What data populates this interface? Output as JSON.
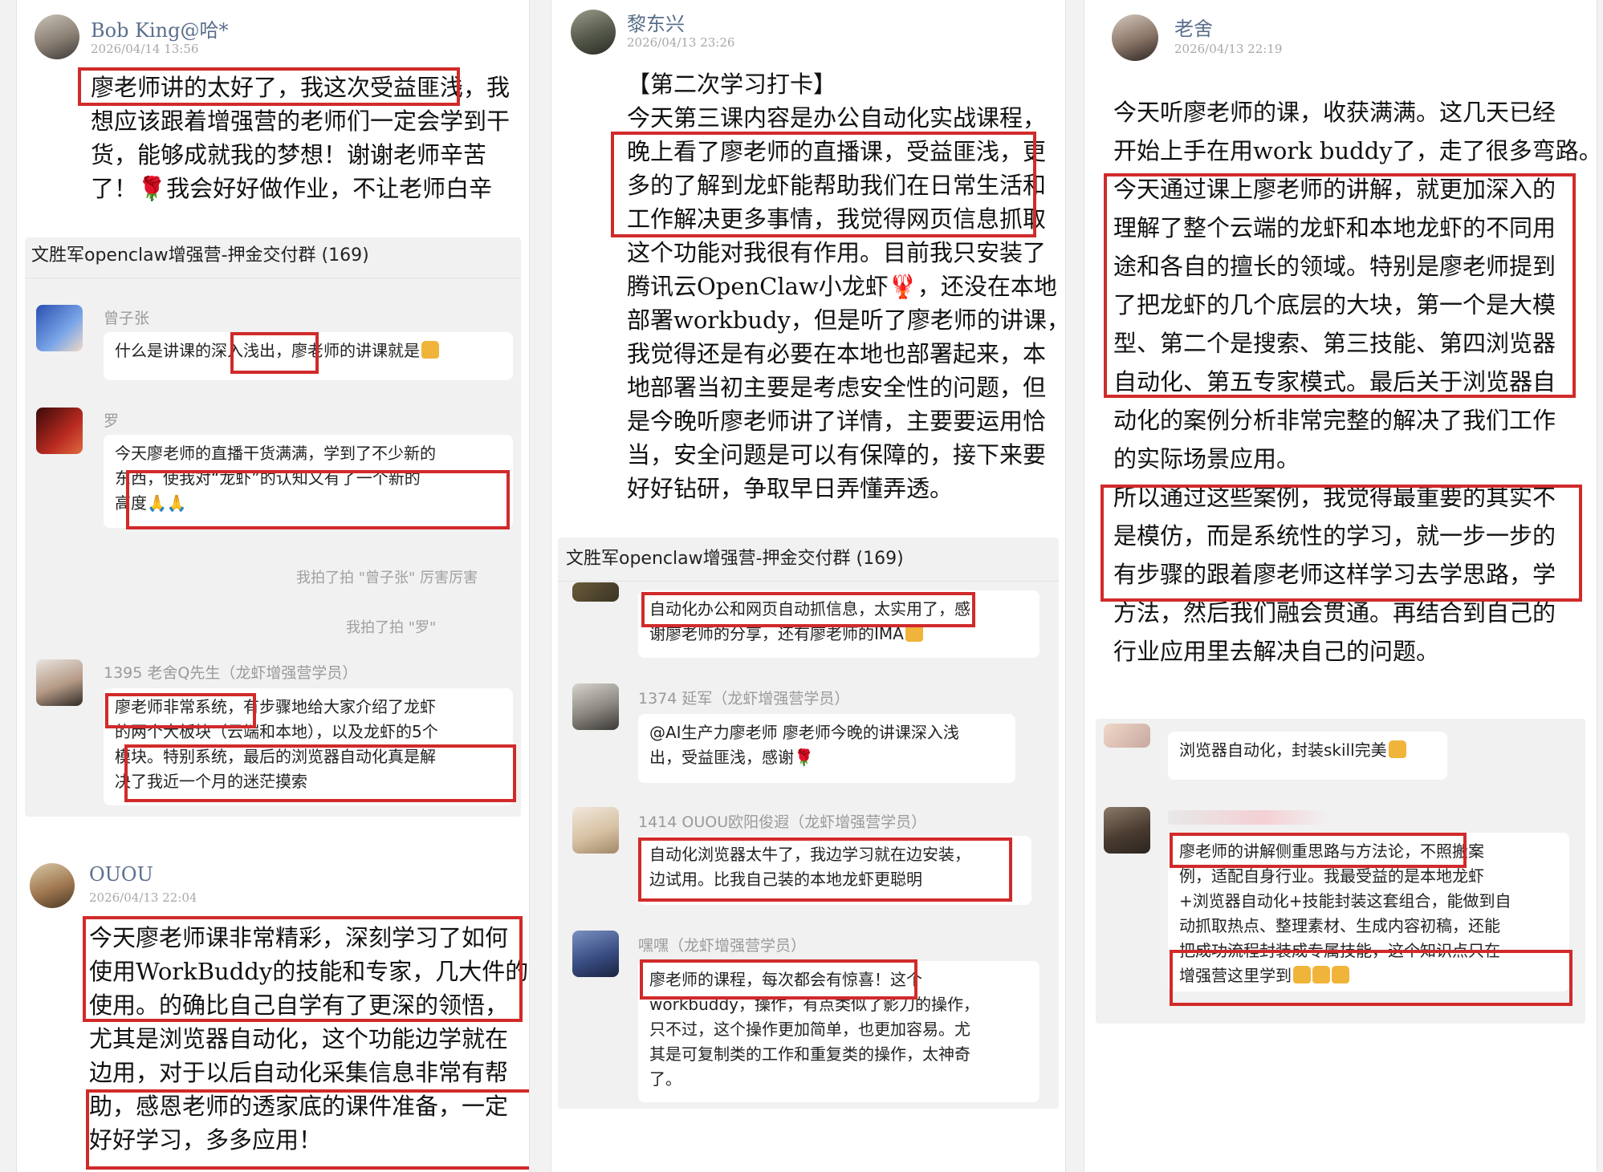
{
  "col1": {
    "post1": {
      "user": "Bob King@哈*",
      "time": "2026/04/14 13:56",
      "lines": [
        "廖老师讲的太好了，我这次受益匪浅，我",
        "想应该跟着增强营的老师们一定会学到干",
        "货，能够成就我的梦想！谢谢老师辛苦",
        "了！🌹我会好好做作业，不让老师白辛"
      ]
    },
    "chat1": {
      "group_title": "文胜军openclaw增强营-押金交付群 (169)",
      "msg1": {
        "sender": "曾子张",
        "text": "什么是讲课的深入浅出，廖老师的讲课就是"
      },
      "msg2": {
        "sender": "罗",
        "lines": [
          "今天廖老师的直播干货满满，学到了不少新的",
          "东西，使我对“龙虾”的认知又有了一个新的",
          "高度🙏🙏"
        ]
      },
      "pat1": "我拍了拍 \"曾子张\" 厉害厉害",
      "pat2": "我拍了拍 \"罗\"",
      "msg3": {
        "sender": "1395 老舍Q先生（龙虾增强营学员）",
        "lines": [
          "廖老师非常系统，有步骤地给大家介绍了龙虾",
          "的两个大板块（云端和本地），以及龙虾的5个",
          "模块。特别系统，最后的浏览器自动化真是解",
          "决了我近一个月的迷茫摸索"
        ]
      }
    },
    "post2": {
      "user": "OUOU",
      "time": "2026/04/13 22:04",
      "lines": [
        "今天廖老师课非常精彩，深刻学习了如何",
        "使用WorkBuddy的技能和专家，几大件的",
        "使用。的确比自己自学有了更深的领悟，",
        "尤其是浏览器自动化，这个功能边学就在",
        "边用，对于以后自动化采集信息非常有帮",
        "助，感恩老师的透家底的课件准备，一定",
        "好好学习，多多应用！"
      ]
    }
  },
  "col2": {
    "post1": {
      "user": "黎东兴",
      "time": "2026/04/13 23:26",
      "lines": [
        "【第二次学习打卡】",
        "今天第三课内容是办公自动化实战课程，",
        "晚上看了廖老师的直播课，受益匪浅，更",
        "多的了解到龙虾能帮助我们在日常生活和",
        "工作解决更多事情，我觉得网页信息抓取",
        "这个功能对我很有作用。目前我只安装了",
        "腾讯云OpenClaw小龙虾🦞，还没在本地",
        "部署workbudy，但是听了廖老师的讲课，",
        "我觉得还是有必要在本地也部署起来，本",
        "地部署当初主要是考虑安全性的问题，但",
        "是今晚听廖老师讲了详情，主要要运用恰",
        "当，安全问题是可以有保障的，接下来要",
        "好好钻研，争取早日弄懂弄透。"
      ]
    },
    "chat": {
      "group_title": "文胜军openclaw增强营-押金交付群 (169)",
      "msg1": {
        "lines": [
          "自动化办公和网页自动抓信息，太实用了，感",
          "谢廖老师的分享，还有廖老师的IMA"
        ]
      },
      "msg2": {
        "sender": "1374 延军（龙虾增强营学员）",
        "lines": [
          "@AI生产力廖老师 廖老师今晚的讲课深入浅",
          "出，受益匪浅，感谢🌹"
        ]
      },
      "msg3": {
        "sender": "1414 OUOU欧阳俊遐（龙虾增强营学员）",
        "lines": [
          "自动化浏览器太牛了，我边学习就在边安装，",
          "边试用。比我自己装的本地龙虾更聪明"
        ]
      },
      "msg4": {
        "sender": "嘿嘿（龙虾增强营学员）",
        "lines": [
          "廖老师的课程，每次都会有惊喜！这个",
          "workbuddy，操作，有点类似了影刀的操作，",
          "只不过，这个操作更加简单，也更加容易。尤",
          "其是可复制类的工作和重复类的操作，太神奇",
          "了。"
        ]
      }
    }
  },
  "col3": {
    "post1": {
      "user": "老舍",
      "time": "2026/04/13 22:19",
      "lines": [
        "今天听廖老师的课，收获满满。这几天已经",
        "开始上手在用work buddy了，走了很多弯路。",
        "今天通过课上廖老师的讲解，就更加深入的",
        "理解了整个云端的龙虾和本地龙虾的不同用",
        "途和各自的擅长的领域。特别是廖老师提到",
        "了把龙虾的几个底层的大块，第一个是大模",
        "型、第二个是搜索、第三技能、第四浏览器",
        "自动化、第五专家模式。最后关于浏览器自",
        "动化的案例分析非常完整的解决了我们工作",
        "的实际场景应用。",
        "所以通过这些案例，我觉得最重要的其实不",
        "是模仿，而是系统性的学习，就一步一步的",
        "有步骤的跟着廖老师这样学习去学思路，学",
        "方法，然后我们融会贯通。再结合到自己的",
        "行业应用里去解决自己的问题。"
      ]
    },
    "chat": {
      "msg1": {
        "text": "浏览器自动化，封装skill完美"
      },
      "msg2": {
        "lines": [
          "廖老师的讲解侧重思路与方法论，不照搬案",
          "例，适配自身行业。我最受益的是本地龙虾",
          "+浏览器自动化+技能封装这套组合，能做到自",
          "动抓取热点、整理素材、生成内容初稿，还能",
          "把成功流程封装成专属技能，这个知识点只在",
          "增强营这里学到"
        ]
      }
    }
  }
}
